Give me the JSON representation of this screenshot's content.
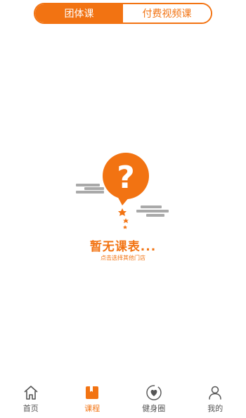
{
  "header": {
    "tabs": [
      {
        "label": "团体课",
        "active": true
      },
      {
        "label": "付费视频课",
        "active": false
      }
    ]
  },
  "empty_state": {
    "title": "暂无课表...",
    "subtitle": "点击选择其他门店",
    "icon": "question-bubble-icon"
  },
  "tabbar": {
    "items": [
      {
        "label": "首页",
        "icon": "home-icon",
        "active": false
      },
      {
        "label": "课程",
        "icon": "book-icon",
        "active": true
      },
      {
        "label": "健身圈",
        "icon": "heart-circle-icon",
        "active": false
      },
      {
        "label": "我的",
        "icon": "user-icon",
        "active": false
      }
    ]
  },
  "colors": {
    "accent": "#f27312",
    "text_inactive": "#555555",
    "cloud_gray": "#a9a9a9"
  }
}
